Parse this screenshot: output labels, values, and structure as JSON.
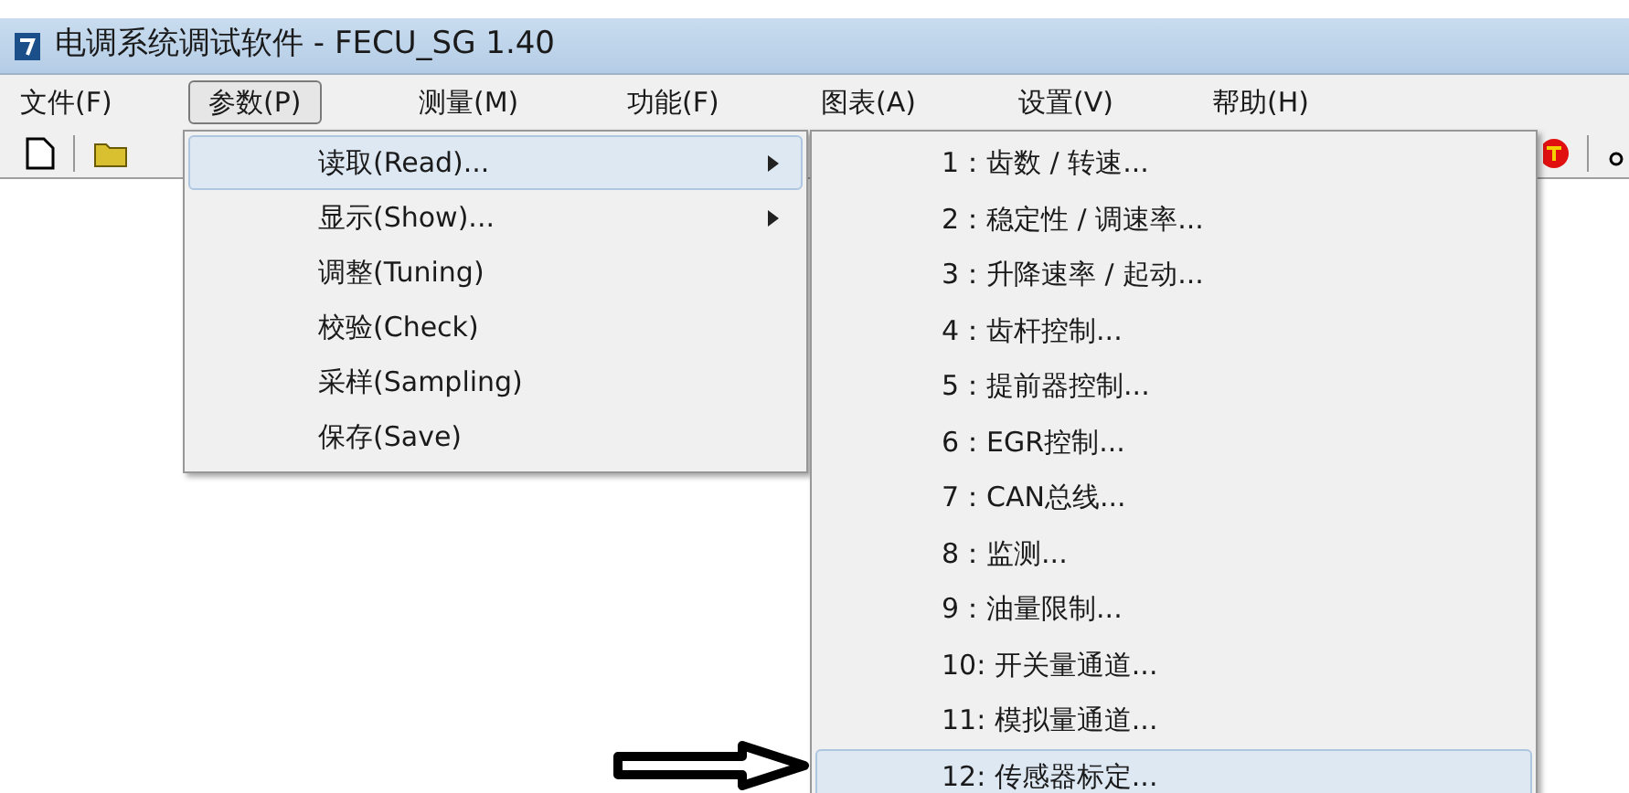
{
  "window": {
    "title": "电调系统调试软件 - FECU_SG 1.40"
  },
  "menubar": [
    {
      "label": "文件(F)",
      "selected": false
    },
    {
      "label": "参数(P)",
      "selected": true
    },
    {
      "label": "测量(M)",
      "selected": false
    },
    {
      "label": "功能(F)",
      "selected": false
    },
    {
      "label": "图表(A)",
      "selected": false
    },
    {
      "label": "设置(V)",
      "selected": false
    },
    {
      "label": "帮助(H)",
      "selected": false
    }
  ],
  "menu": [
    {
      "label": "读取(Read)...",
      "submenu": true,
      "selected": true
    },
    {
      "label": "显示(Show)...",
      "submenu": true,
      "selected": false
    },
    {
      "label": "调整(Tuning)",
      "submenu": false,
      "selected": false
    },
    {
      "label": "校验(Check)",
      "submenu": false,
      "selected": false
    },
    {
      "label": "采样(Sampling)",
      "submenu": false,
      "selected": false
    },
    {
      "label": "保存(Save)",
      "submenu": false,
      "selected": false
    }
  ],
  "submenu": [
    {
      "label": "1：齿数 / 转速...",
      "selected": false
    },
    {
      "label": "2：稳定性 / 调速率...",
      "selected": false
    },
    {
      "label": "3：升降速率 / 起动...",
      "selected": false
    },
    {
      "label": "4：齿杆控制...",
      "selected": false
    },
    {
      "label": "5：提前器控制...",
      "selected": false
    },
    {
      "label": "6：EGR控制...",
      "selected": false
    },
    {
      "label": "7：CAN总线...",
      "selected": false
    },
    {
      "label": "8：监测...",
      "selected": false
    },
    {
      "label": "9：油量限制...",
      "selected": false
    },
    {
      "label": "10: 开关量通道...",
      "selected": false
    },
    {
      "label": "11: 模拟量通道...",
      "selected": false
    },
    {
      "label": "12: 传感器标定...",
      "selected": true
    }
  ]
}
